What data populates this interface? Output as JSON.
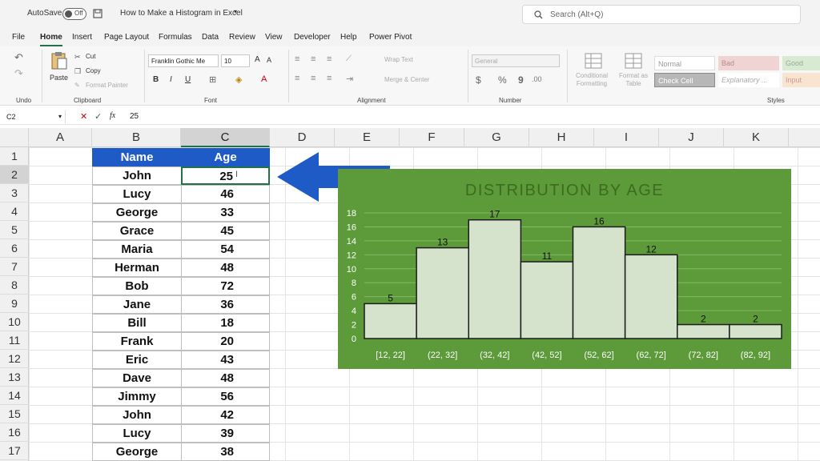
{
  "titlebar": {
    "autosave_label": "AutoSave",
    "autosave_state": "Off",
    "doc_title": "How to Make a Histogram in Excel",
    "search_placeholder": "Search (Alt+Q)"
  },
  "tabs": [
    "File",
    "Home",
    "Insert",
    "Page Layout",
    "Formulas",
    "Data",
    "Review",
    "View",
    "Developer",
    "Help",
    "Power Pivot"
  ],
  "active_tab": "Home",
  "ribbon": {
    "groups": [
      "Undo",
      "Clipboard",
      "Font",
      "Alignment",
      "Number",
      "Styles"
    ],
    "clipboard": {
      "paste": "Paste",
      "cut": "Cut",
      "copy": "Copy",
      "format_painter": "Format Painter"
    },
    "font": {
      "name": "Franklin Gothic Me",
      "size": "10",
      "bold": "B",
      "italic": "I",
      "underline": "U"
    },
    "alignment": {
      "wrap": "Wrap Text",
      "merge": "Merge & Center"
    },
    "number": {
      "format": "General",
      "currency": "$",
      "percent": "%",
      "comma": "9"
    },
    "styles": {
      "cond_format": "Conditional Formatting",
      "format_table": "Format as Table",
      "cells": [
        "Normal",
        "Bad",
        "Good",
        "Check Cell",
        "Explanatory ...",
        "Input"
      ]
    }
  },
  "formula_bar": {
    "name_box": "C2",
    "fx": "fx",
    "value": "25"
  },
  "columns": [
    "A",
    "B",
    "C",
    "D",
    "E",
    "F",
    "G",
    "H",
    "I",
    "J",
    "K"
  ],
  "rows": [
    "1",
    "2",
    "3",
    "4",
    "5",
    "6",
    "7",
    "8",
    "9",
    "10",
    "11",
    "12",
    "13",
    "14",
    "15",
    "16",
    "17"
  ],
  "table": {
    "headers": [
      "Name",
      "Age"
    ],
    "rows": [
      [
        "John",
        "25"
      ],
      [
        "Lucy",
        "46"
      ],
      [
        "George",
        "33"
      ],
      [
        "Grace",
        "45"
      ],
      [
        "Maria",
        "54"
      ],
      [
        "Herman",
        "48"
      ],
      [
        "Bob",
        "72"
      ],
      [
        "Jane",
        "36"
      ],
      [
        "Bill",
        "18"
      ],
      [
        "Frank",
        "20"
      ],
      [
        "Eric",
        "43"
      ],
      [
        "Dave",
        "48"
      ],
      [
        "Jimmy",
        "56"
      ],
      [
        "John",
        "42"
      ],
      [
        "Lucy",
        "39"
      ],
      [
        "George",
        "38"
      ]
    ]
  },
  "colors": {
    "header_blue": "#1e5bc6",
    "chart_bg": "#5d9a3a",
    "bar_fill": "#d5e3cc",
    "arrow": "#1e5bc6",
    "excel_green": "#217346"
  },
  "chart_data": {
    "type": "bar",
    "title": "DISTRIBUTION BY AGE",
    "categories": [
      "[12, 22]",
      "(22, 32]",
      "(32, 42]",
      "(42, 52]",
      "(52, 62]",
      "(62, 72]",
      "(72, 82]",
      "(82, 92]"
    ],
    "values": [
      5,
      13,
      17,
      11,
      16,
      12,
      2,
      2
    ],
    "ylim": [
      0,
      18
    ],
    "yticks": [
      "0",
      "2",
      "4",
      "6",
      "8",
      "10",
      "12",
      "14",
      "16",
      "18"
    ],
    "grid": true,
    "legend": "none"
  }
}
